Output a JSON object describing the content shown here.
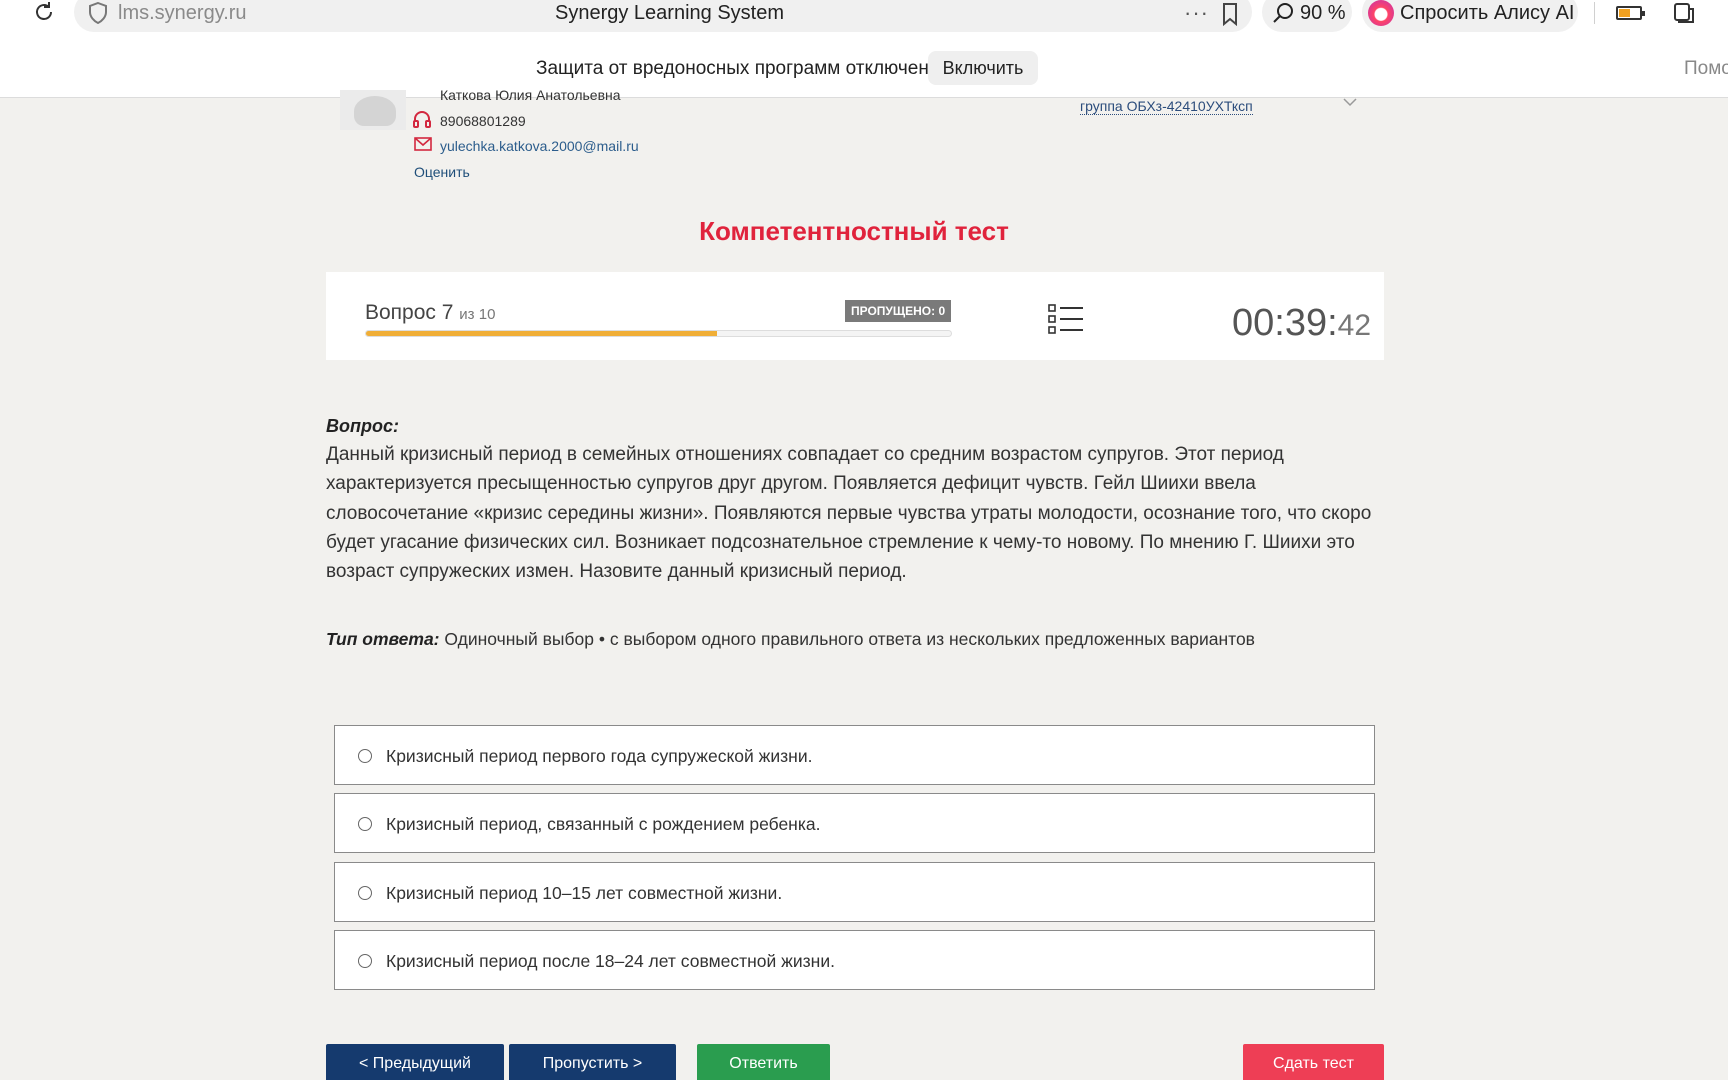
{
  "browser": {
    "url": "lms.synergy.ru",
    "page_title": "Synergy Learning System",
    "zoom": "90 %",
    "alice_label": "Спросить Алису AI",
    "protection_notice": "Защита от вредоносных программ отключена",
    "protection_button": "Включить",
    "help_partial": "Помо"
  },
  "profile": {
    "name_partial": "Каткова Юлия Анатольевна",
    "phone": "89068801289",
    "email": "yulechka.katkova.2000@mail.ru",
    "rate_label": "Оценить",
    "group": "группа ОБХз-42410УХТксп"
  },
  "test": {
    "title": "Компетентностный тест",
    "question_label": "Вопрос",
    "question_number": "7",
    "question_total": "из 10",
    "skipped": "ПРОПУЩЕНО: 0",
    "progress_fraction": 0.6,
    "timer_main": "00:39:",
    "timer_seconds": "42"
  },
  "question": {
    "label": "Вопрос:",
    "text": "Данный кризисный период в семейных отношениях совпадает со средним возрастом супругов. Этот период характеризуется пресыщенностью супругов друг другом. Появляется дефицит чувств. Гейл Шиихи ввела словосочетание «кризис середины жизни». Появляются первые чувства утраты молодости, осознание того, что скоро будет угасание физических сил. Возникает подсознательное стремление к чему-то новому. По мнению Г. Шиихи это возраст супружеских измен. Назовите данный кризисный период.",
    "answer_type_label": "Тип ответа:",
    "answer_type": "Одиночный выбор • с выбором одного правильного ответа из нескольких предложенных вариантов"
  },
  "options": [
    "Кризисный период первого года супружеской жизни.",
    "Кризисный период, связанный с рождением ребенка.",
    "Кризисный период 10–15 лет совместной жизни.",
    "Кризисный период после 18–24 лет совместной жизни."
  ],
  "buttons": {
    "prev": "< Предыдущий",
    "skip": "Пропустить >",
    "answer": "Ответить",
    "submit": "Сдать тест"
  },
  "colors": {
    "title_red": "#e0233c",
    "progress_orange": "#f0ae36",
    "navy_button": "#153a6e",
    "green_button": "#2a9d4f",
    "submit_red": "#ee3e55"
  }
}
